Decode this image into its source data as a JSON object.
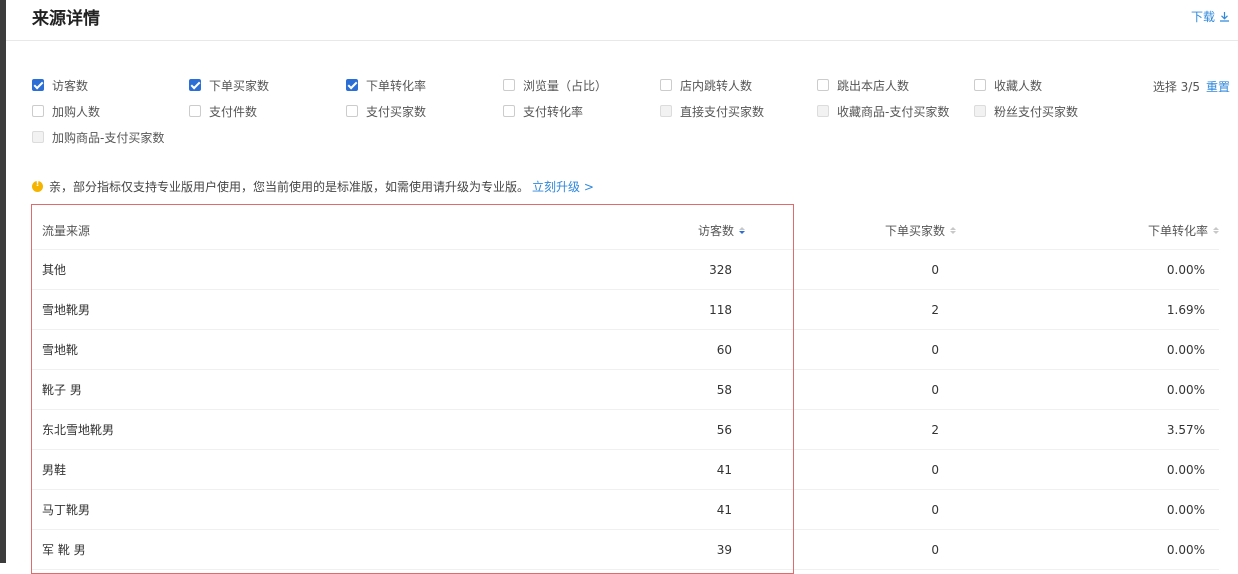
{
  "header": {
    "title": "来源详情",
    "download_label": "下载"
  },
  "metrics": [
    {
      "label": "访客数",
      "state": "checked"
    },
    {
      "label": "下单买家数",
      "state": "checked"
    },
    {
      "label": "下单转化率",
      "state": "checked"
    },
    {
      "label": "浏览量（占比）",
      "state": "unchecked"
    },
    {
      "label": "店内跳转人数",
      "state": "unchecked"
    },
    {
      "label": "跳出本店人数",
      "state": "unchecked"
    },
    {
      "label": "收藏人数",
      "state": "unchecked"
    },
    {
      "label": "加购人数",
      "state": "unchecked"
    },
    {
      "label": "支付件数",
      "state": "unchecked"
    },
    {
      "label": "支付买家数",
      "state": "unchecked"
    },
    {
      "label": "支付转化率",
      "state": "unchecked"
    },
    {
      "label": "直接支付买家数",
      "state": "disabled"
    },
    {
      "label": "收藏商品-支付买家数",
      "state": "disabled"
    },
    {
      "label": "粉丝支付买家数",
      "state": "disabled"
    },
    {
      "label": "加购商品-支付买家数",
      "state": "disabled"
    }
  ],
  "selection": {
    "count_text": "选择 3/5",
    "reset_label": "重置"
  },
  "notice": {
    "text": "亲，部分指标仅支持专业版用户使用，您当前使用的是标准版，如需使用请升级为专业版。",
    "link": "立刻升级 >"
  },
  "table": {
    "headers": {
      "source": "流量来源",
      "visitors": "访客数",
      "buyers": "下单买家数",
      "rate": "下单转化率"
    },
    "rows": [
      {
        "source": "其他",
        "visitors": "328",
        "buyers": "0",
        "rate": "0.00%"
      },
      {
        "source": "雪地靴男",
        "visitors": "118",
        "buyers": "2",
        "rate": "1.69%"
      },
      {
        "source": "雪地靴",
        "visitors": "60",
        "buyers": "0",
        "rate": "0.00%"
      },
      {
        "source": "靴子 男",
        "visitors": "58",
        "buyers": "0",
        "rate": "0.00%"
      },
      {
        "source": "东北雪地靴男",
        "visitors": "56",
        "buyers": "2",
        "rate": "3.57%"
      },
      {
        "source": "男鞋",
        "visitors": "41",
        "buyers": "0",
        "rate": "0.00%"
      },
      {
        "source": "马丁靴男",
        "visitors": "41",
        "buyers": "0",
        "rate": "0.00%"
      },
      {
        "source": "军 靴 男",
        "visitors": "39",
        "buyers": "0",
        "rate": "0.00%"
      }
    ]
  }
}
